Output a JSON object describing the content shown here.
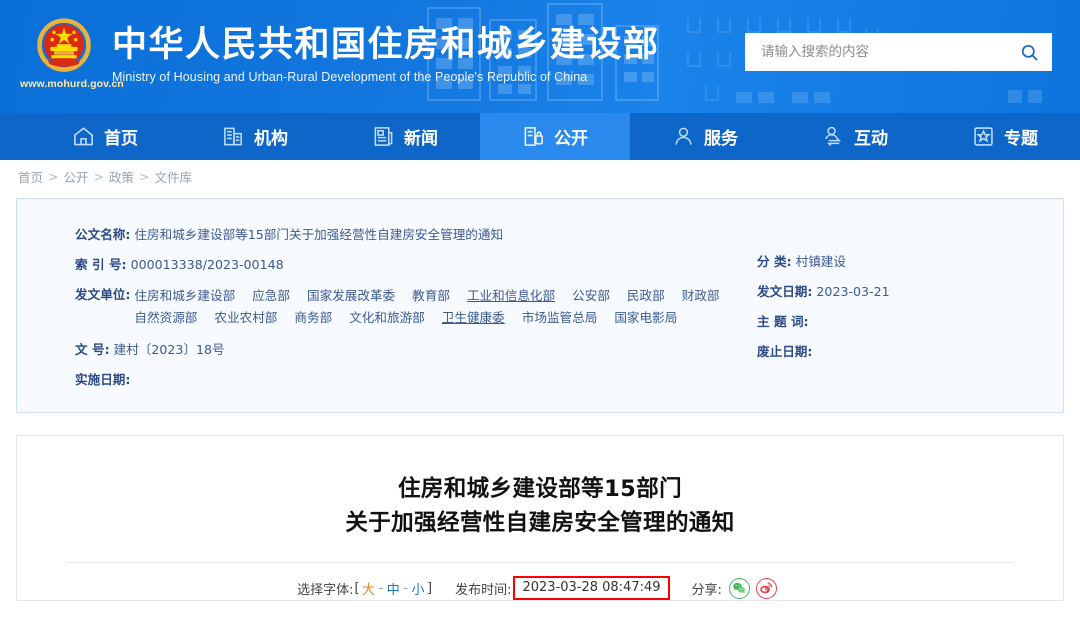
{
  "header": {
    "title_cn": "中华人民共和国住房和城乡建设部",
    "title_en": "Ministry of Housing and Urban-Rural Development of the People's Republic of China",
    "site_url": "www.mohurd.gov.cn",
    "emblem_icon": "national-emblem-icon",
    "search": {
      "placeholder": "请输入搜索的内容",
      "value": "",
      "button_icon": "search-icon"
    },
    "colors": {
      "header_blue": "#1277de",
      "nav_blue": "#0d66c8",
      "nav_active_blue": "#2a8aee",
      "emblem_gold": "#e8b33a",
      "emblem_red": "#de2910"
    }
  },
  "nav": {
    "items": [
      {
        "label": "首页",
        "icon": "home-icon",
        "active": false
      },
      {
        "label": "机构",
        "icon": "building-icon",
        "active": false
      },
      {
        "label": "新闻",
        "icon": "news-document-icon",
        "active": false
      },
      {
        "label": "公开",
        "icon": "open-disclosure-icon",
        "active": true
      },
      {
        "label": "服务",
        "icon": "user-service-icon",
        "active": false
      },
      {
        "label": "互动",
        "icon": "interaction-icon",
        "active": false
      },
      {
        "label": "专题",
        "icon": "star-box-icon",
        "active": false
      }
    ]
  },
  "breadcrumb": {
    "items": [
      "首页",
      "公开",
      "政策",
      "文件库"
    ],
    "separator": ">"
  },
  "info_card": {
    "left_fields": [
      {
        "label": "公文名称:",
        "value": "住房和城乡建设部等15部门关于加强经营性自建房安全管理的通知"
      },
      {
        "label": "索 引 号:",
        "value": "000013338/2023-00148"
      }
    ],
    "issuer_label": "发文单位:",
    "issuers": [
      {
        "name": "住房和城乡建设部",
        "underline": false
      },
      {
        "name": "应急部",
        "underline": false
      },
      {
        "name": "国家发展改革委",
        "underline": false
      },
      {
        "name": "教育部",
        "underline": false
      },
      {
        "name": "工业和信息化部",
        "underline": true
      },
      {
        "name": "公安部",
        "underline": false
      },
      {
        "name": "民政部",
        "underline": false
      },
      {
        "name": "财政部",
        "underline": false
      },
      {
        "name": "自然资源部",
        "underline": false
      },
      {
        "name": "农业农村部",
        "underline": false
      },
      {
        "name": "商务部",
        "underline": false
      },
      {
        "name": "文化和旅游部",
        "underline": false
      },
      {
        "name": "卫生健康委",
        "underline": true
      },
      {
        "name": "市场监管总局",
        "underline": false
      },
      {
        "name": "国家电影局",
        "underline": false
      }
    ],
    "doc_number_label": "文      号:",
    "doc_number_value": "建村〔2023〕18号",
    "effective_label": "实施日期:",
    "effective_value": "",
    "right_fields": [
      {
        "label": "分      类:",
        "value": "村镇建设"
      },
      {
        "label": "发文日期:",
        "value": "2023-03-21"
      },
      {
        "label": "主 题 词:",
        "value": ""
      },
      {
        "label": "废止日期:",
        "value": ""
      }
    ]
  },
  "document": {
    "title_line1": "住房和城乡建设部等15部门",
    "title_line2": "关于加强经营性自建房安全管理的通知",
    "toolbar": {
      "font_label": "选择字体:",
      "bracket_open": "[",
      "bracket_close": "]",
      "font_options": [
        {
          "label": "大",
          "color": "#e8860c"
        },
        {
          "label": "中",
          "color": "#1a73c8"
        },
        {
          "label": "小",
          "color": "#1a73c8"
        }
      ],
      "font_separator": "-",
      "publish_label": "发布时间:",
      "publish_time": "2023-03-28 08:47:49",
      "publish_highlight_color": "#ff0000",
      "share_label": "分享:",
      "share_icons": [
        {
          "name": "wechat-share-icon",
          "color": "#3fb84f"
        },
        {
          "name": "weibo-share-icon",
          "color": "#e6404a"
        }
      ]
    }
  }
}
